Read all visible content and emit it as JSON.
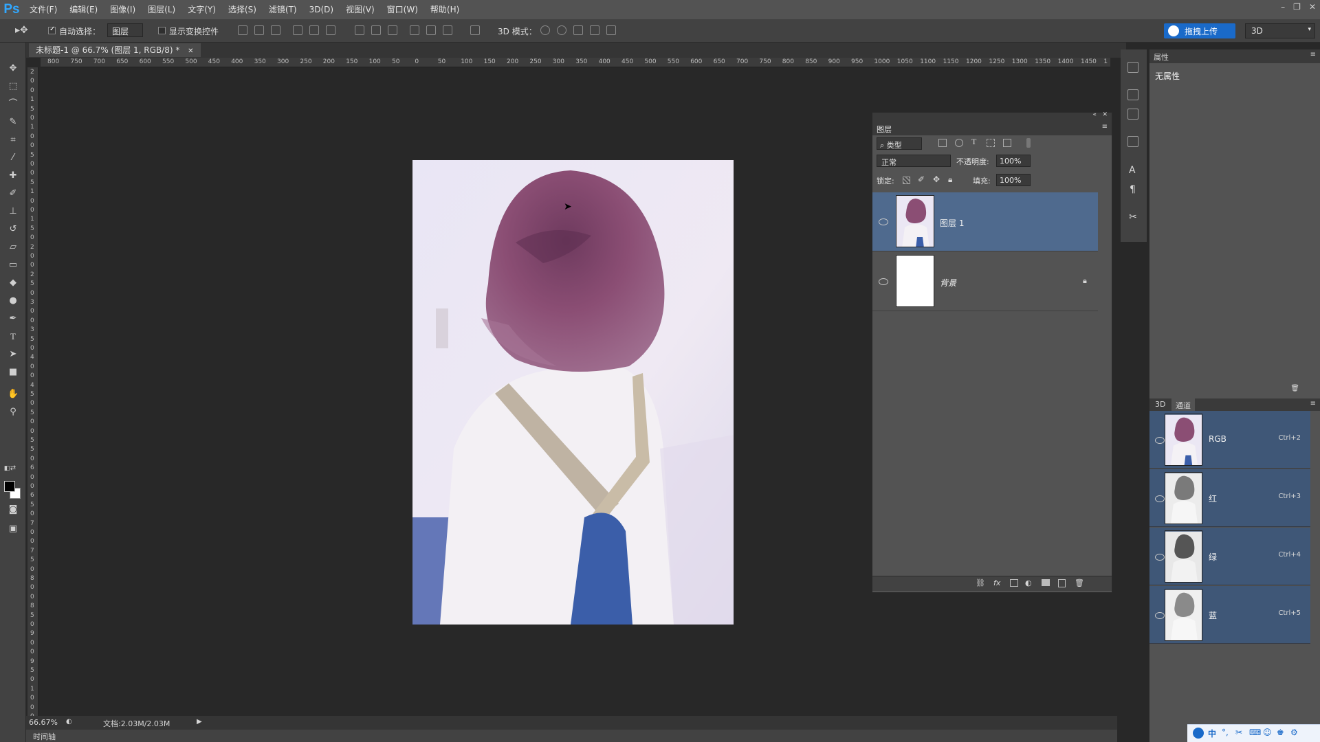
{
  "app": {
    "logo": "Ps"
  },
  "menu": [
    "文件(F)",
    "编辑(E)",
    "图像(I)",
    "图层(L)",
    "文字(Y)",
    "选择(S)",
    "滤镜(T)",
    "3D(D)",
    "视图(V)",
    "窗口(W)",
    "帮助(H)"
  ],
  "options": {
    "auto_select_label": "自动选择：",
    "auto_select_value": "图层",
    "show_transform_label": "显示变换控件",
    "mode_3d_label": "3D 模式：",
    "upload_label": "拖拽上传",
    "workspace": "3D"
  },
  "document": {
    "tab_title": "未标题-1 @ 66.7% (图层 1, RGB/8) *",
    "zoom": "66.67%",
    "doc_size": "文档:2.03M/2.03M"
  },
  "ruler_top": [
    "800",
    "750",
    "700",
    "650",
    "600",
    "550",
    "500",
    "450",
    "400",
    "350",
    "300",
    "250",
    "200",
    "150",
    "100",
    "50",
    "0",
    "50",
    "100",
    "150",
    "200",
    "250",
    "300",
    "350",
    "400",
    "450",
    "500",
    "550",
    "600",
    "650",
    "700",
    "750",
    "800",
    "850",
    "900",
    "950",
    "1000",
    "1050",
    "1100",
    "1150",
    "1200",
    "1250",
    "1300",
    "1350",
    "1400",
    "1450",
    "1"
  ],
  "ruler_left": [
    "2",
    "0",
    "0",
    "1",
    "5",
    "0",
    "1",
    "0",
    "0",
    "5",
    "0",
    "0",
    "5",
    "1",
    "0",
    "0",
    "1",
    "5",
    "0",
    "2",
    "0",
    "0",
    "2",
    "5",
    "0",
    "3",
    "0",
    "0",
    "3",
    "5",
    "0",
    "4",
    "0",
    "0",
    "4",
    "5",
    "0",
    "5",
    "0",
    "0",
    "5",
    "5",
    "0",
    "6",
    "0",
    "0",
    "6",
    "5",
    "0",
    "7",
    "0",
    "0",
    "7",
    "5",
    "0",
    "8",
    "0",
    "0",
    "8",
    "5",
    "0",
    "9",
    "0",
    "0",
    "9",
    "5",
    "0",
    "1",
    "0",
    "0",
    "0"
  ],
  "timeline_label": "时间轴",
  "layers_panel": {
    "title": "图层",
    "filter_kind": "类型",
    "blend_mode": "正常",
    "opacity_label": "不透明度:",
    "opacity_value": "100%",
    "lock_label": "锁定:",
    "fill_label": "填充:",
    "fill_value": "100%",
    "layers": [
      {
        "name": "图层 1",
        "selected": true
      },
      {
        "name": "背景",
        "selected": false,
        "locked": true
      }
    ]
  },
  "properties_panel": {
    "title": "属性",
    "empty_text": "无属性"
  },
  "channels_panel": {
    "tabs": [
      "3D",
      "通道"
    ],
    "channels": [
      {
        "name": "RGB",
        "shortcut": "Ctrl+2"
      },
      {
        "name": "红",
        "shortcut": "Ctrl+3"
      },
      {
        "name": "绿",
        "shortcut": "Ctrl+4"
      },
      {
        "name": "蓝",
        "shortcut": "Ctrl+5"
      }
    ]
  },
  "colors": {
    "selection": "#4f6a8e",
    "accent": "#1a6ac9",
    "hair": "#8b4e74"
  }
}
